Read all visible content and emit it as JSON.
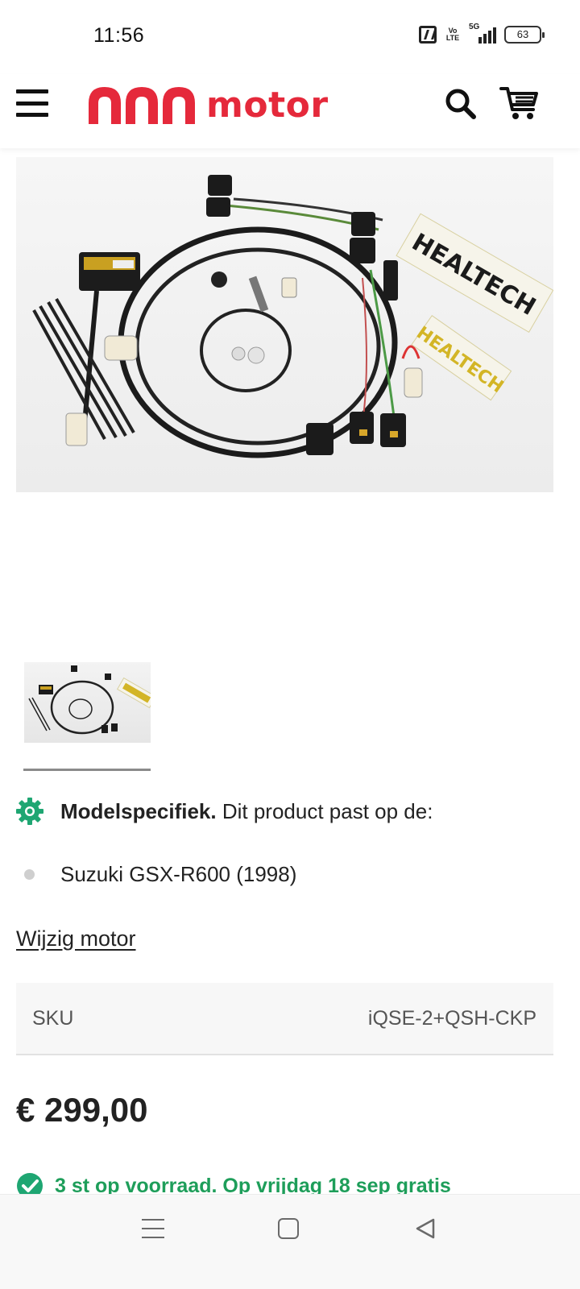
{
  "status_bar": {
    "time": "11:56",
    "network_label": "5G",
    "volte_label": "Vo LTE",
    "battery_level": "63",
    "icons": [
      "nfc-icon",
      "volte-icon",
      "signal-icon",
      "battery-icon"
    ]
  },
  "header": {
    "brand_name": "motor",
    "brand_color": "#e5293b",
    "icons": [
      "menu-icon",
      "logo-mark-icon",
      "search-icon",
      "cart-icon"
    ]
  },
  "product": {
    "model_specific": {
      "bold_text": "Modelspecifiek.",
      "rest_text": " Dit product past op de:",
      "icon": "gear-icon",
      "icon_color": "#1ea672"
    },
    "compatible_bikes": [
      "Suzuki GSX-R600 (1998)"
    ],
    "change_bike_link": "Wijzig motor",
    "sku": {
      "label": "SKU",
      "value": "iQSE-2+QSH-CKP"
    },
    "price": "€ 299,00",
    "stock": {
      "text": "3 st op voorraad. Op vrijdag 18 sep gratis",
      "color": "#1e9e5a",
      "icon": "check-circle-icon"
    },
    "image_branding": {
      "sticker_text": "HEALTECH",
      "device_label": "iQSE-1"
    }
  },
  "nav_bar": {
    "icons": [
      "recents-icon",
      "home-icon",
      "back-icon"
    ]
  }
}
